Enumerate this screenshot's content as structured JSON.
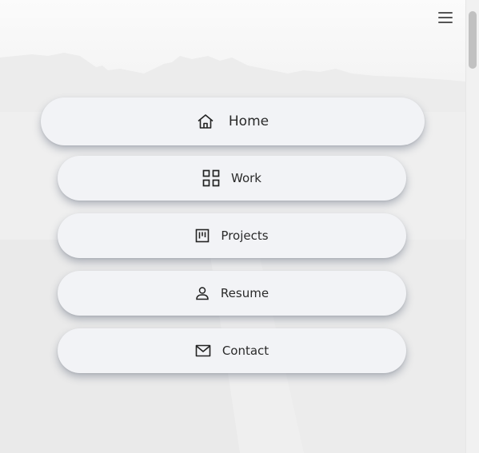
{
  "header": {
    "menu_icon": "hamburger-icon"
  },
  "nav": {
    "items": [
      {
        "id": "home",
        "label": "Home",
        "icon": "home-icon"
      },
      {
        "id": "work",
        "label": "Work",
        "icon": "grid-icon"
      },
      {
        "id": "projects",
        "label": "Projects",
        "icon": "kanban-board-icon"
      },
      {
        "id": "resume",
        "label": "Resume",
        "icon": "user-icon"
      },
      {
        "id": "contact",
        "label": "Contact",
        "icon": "mail-icon"
      }
    ]
  },
  "theme": {
    "button_bg": "#f2f3f6",
    "text": "#2a2a2a",
    "icon": "#222222",
    "background": "#f3f3f3"
  }
}
